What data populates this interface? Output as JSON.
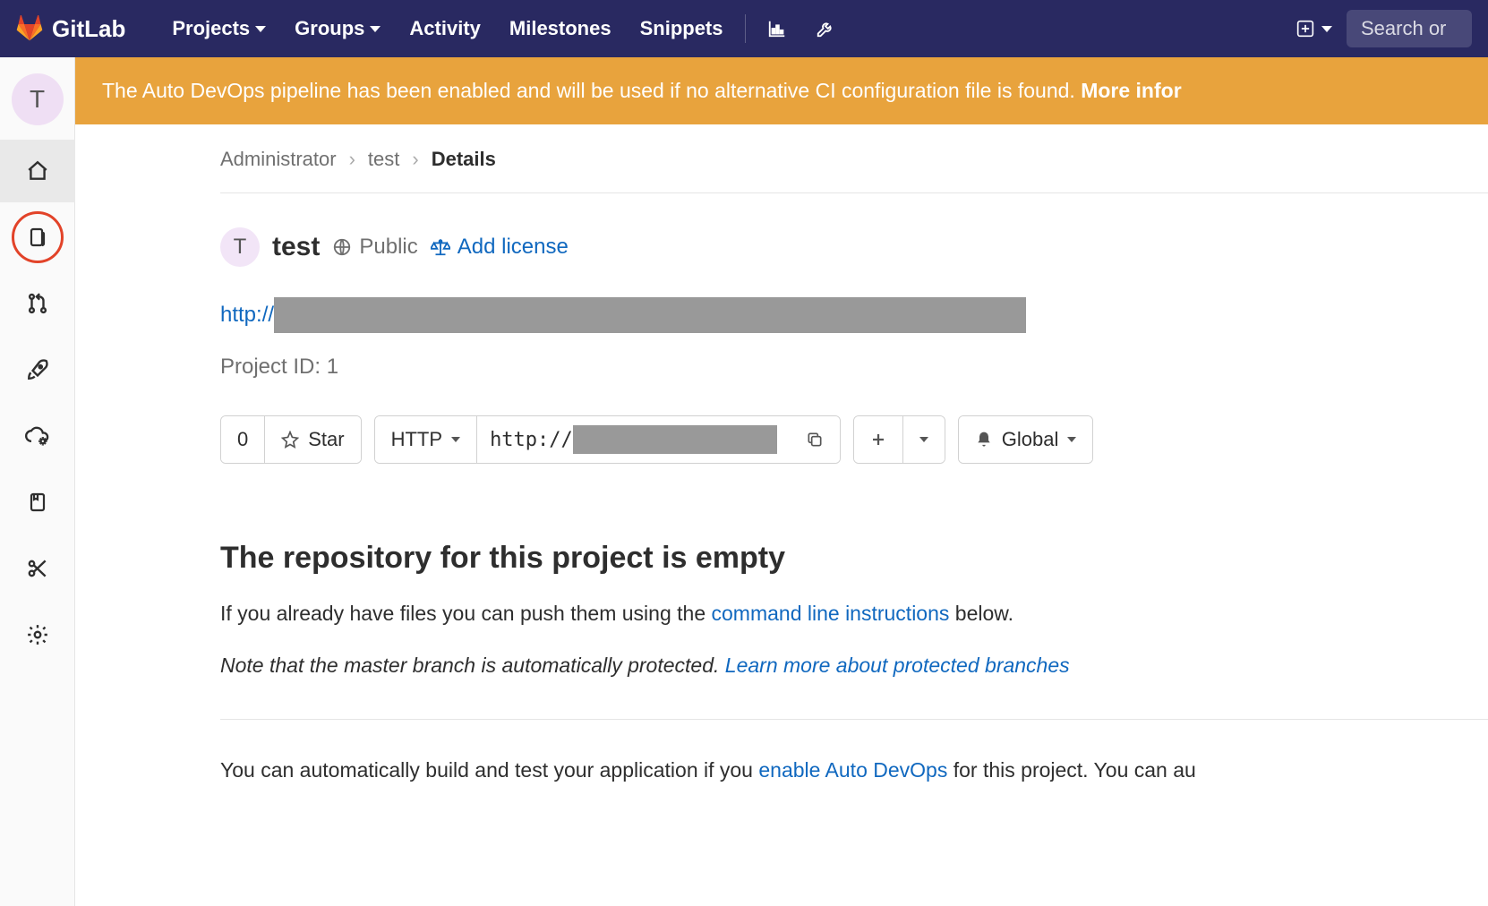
{
  "navbar": {
    "brand": "GitLab",
    "items": [
      "Projects",
      "Groups",
      "Activity",
      "Milestones",
      "Snippets"
    ],
    "search_placeholder": "Search or"
  },
  "sidebar": {
    "avatar_letter": "T"
  },
  "banner": {
    "text_prefix": "The Auto DevOps pipeline has been enabled and will be used if no alternative CI configuration file is found. ",
    "text_bold": "More infor"
  },
  "breadcrumb": {
    "items": [
      "Administrator",
      "test"
    ],
    "current": "Details"
  },
  "project": {
    "avatar_letter": "T",
    "name": "test",
    "visibility": "Public",
    "add_license": "Add license",
    "url_prefix": "http://",
    "id_label": "Project ID: 1"
  },
  "actions": {
    "star_count": "0",
    "star_label": "Star",
    "protocol": "HTTP",
    "clone_prefix": "http://",
    "notification": "Global"
  },
  "empty": {
    "title": "The repository for this project is empty",
    "push_prefix": "If you already have files you can push them using the ",
    "push_link": "command line instructions",
    "push_suffix": " below.",
    "note_prefix": "Note that the master branch is automatically protected. ",
    "note_link": "Learn more about protected branches",
    "auto_prefix": "You can automatically build and test your application if you ",
    "auto_link": "enable Auto DevOps",
    "auto_suffix": " for this project. You can au"
  }
}
